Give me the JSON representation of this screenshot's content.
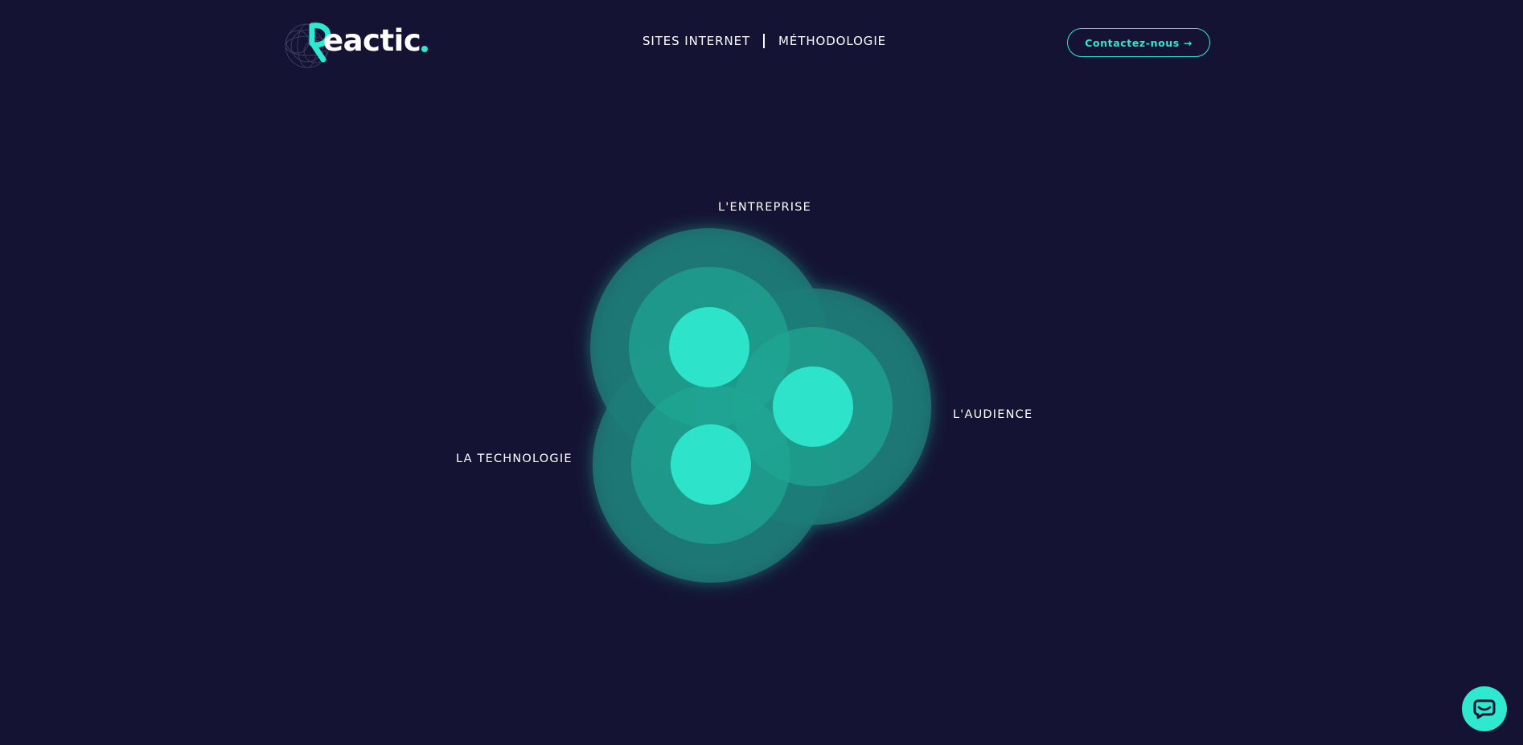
{
  "header": {
    "logo_text": "eactic",
    "nav": [
      {
        "label": "SITES INTERNET"
      },
      {
        "label": "MÉTHODOLOGIE"
      }
    ],
    "contact_label": "Contactez-nous →"
  },
  "diagram": {
    "labels": {
      "entreprise": "L'ENTREPRISE",
      "audience": "L'AUDIENCE",
      "technologie": "LA TECHNOLOGIE"
    }
  },
  "chat": {
    "icon": "chat-bubble-icon"
  },
  "colors": {
    "background": "#151333",
    "accent": "#2ee8cf",
    "ring_outer": "#1d7d78",
    "ring_middle": "#1fa694",
    "core": "#2ee8cf",
    "text": "#ffffff"
  }
}
